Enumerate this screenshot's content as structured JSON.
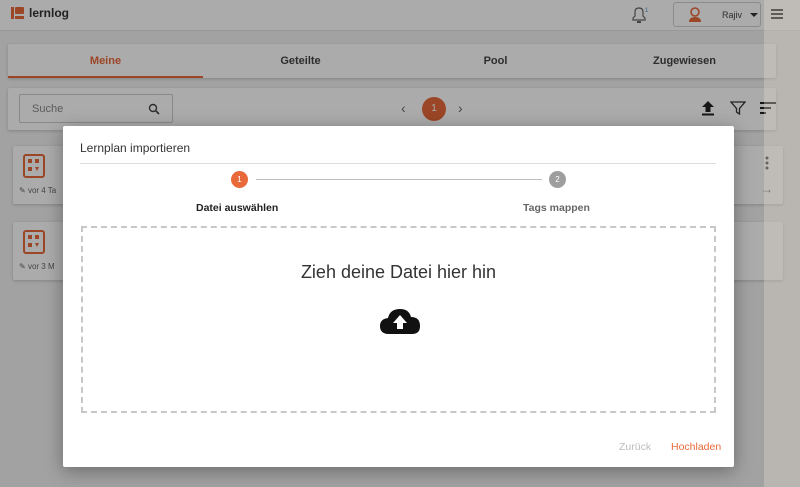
{
  "app": {
    "name": "lernlog"
  },
  "header": {
    "user_name": "Rajiv"
  },
  "tabs": [
    {
      "label": "Meine",
      "active": true
    },
    {
      "label": "Geteilte",
      "active": false
    },
    {
      "label": "Pool",
      "active": false
    },
    {
      "label": "Zugewiesen",
      "active": false
    }
  ],
  "toolbar": {
    "search_placeholder": "Suche",
    "current_page": "1"
  },
  "cards": [
    {
      "meta": "vor 4 Ta"
    },
    {
      "meta": "vor 3 M"
    }
  ],
  "modal": {
    "title": "Lernplan importieren",
    "steps": [
      {
        "number": "1",
        "label": "Datei auswählen",
        "active": true
      },
      {
        "number": "2",
        "label": "Tags mappen",
        "active": false
      }
    ],
    "dropzone_text": "Zieh deine Datei hier hin",
    "back_label": "Zurück",
    "upload_label": "Hochladen"
  },
  "colors": {
    "accent": "#e8693a",
    "inactive_step": "#9e9e9e",
    "disabled_text": "#bdbdbd"
  },
  "icons": {
    "logo": "lernlog-logo-icon",
    "notification": "notification-icon",
    "avatar": "user-avatar-icon",
    "menu": "hamburger-menu-icon",
    "search": "search-icon",
    "upload": "upload-icon",
    "filter": "filter-icon",
    "sort": "sort-icon",
    "cloud_upload": "cloud-upload-icon"
  }
}
